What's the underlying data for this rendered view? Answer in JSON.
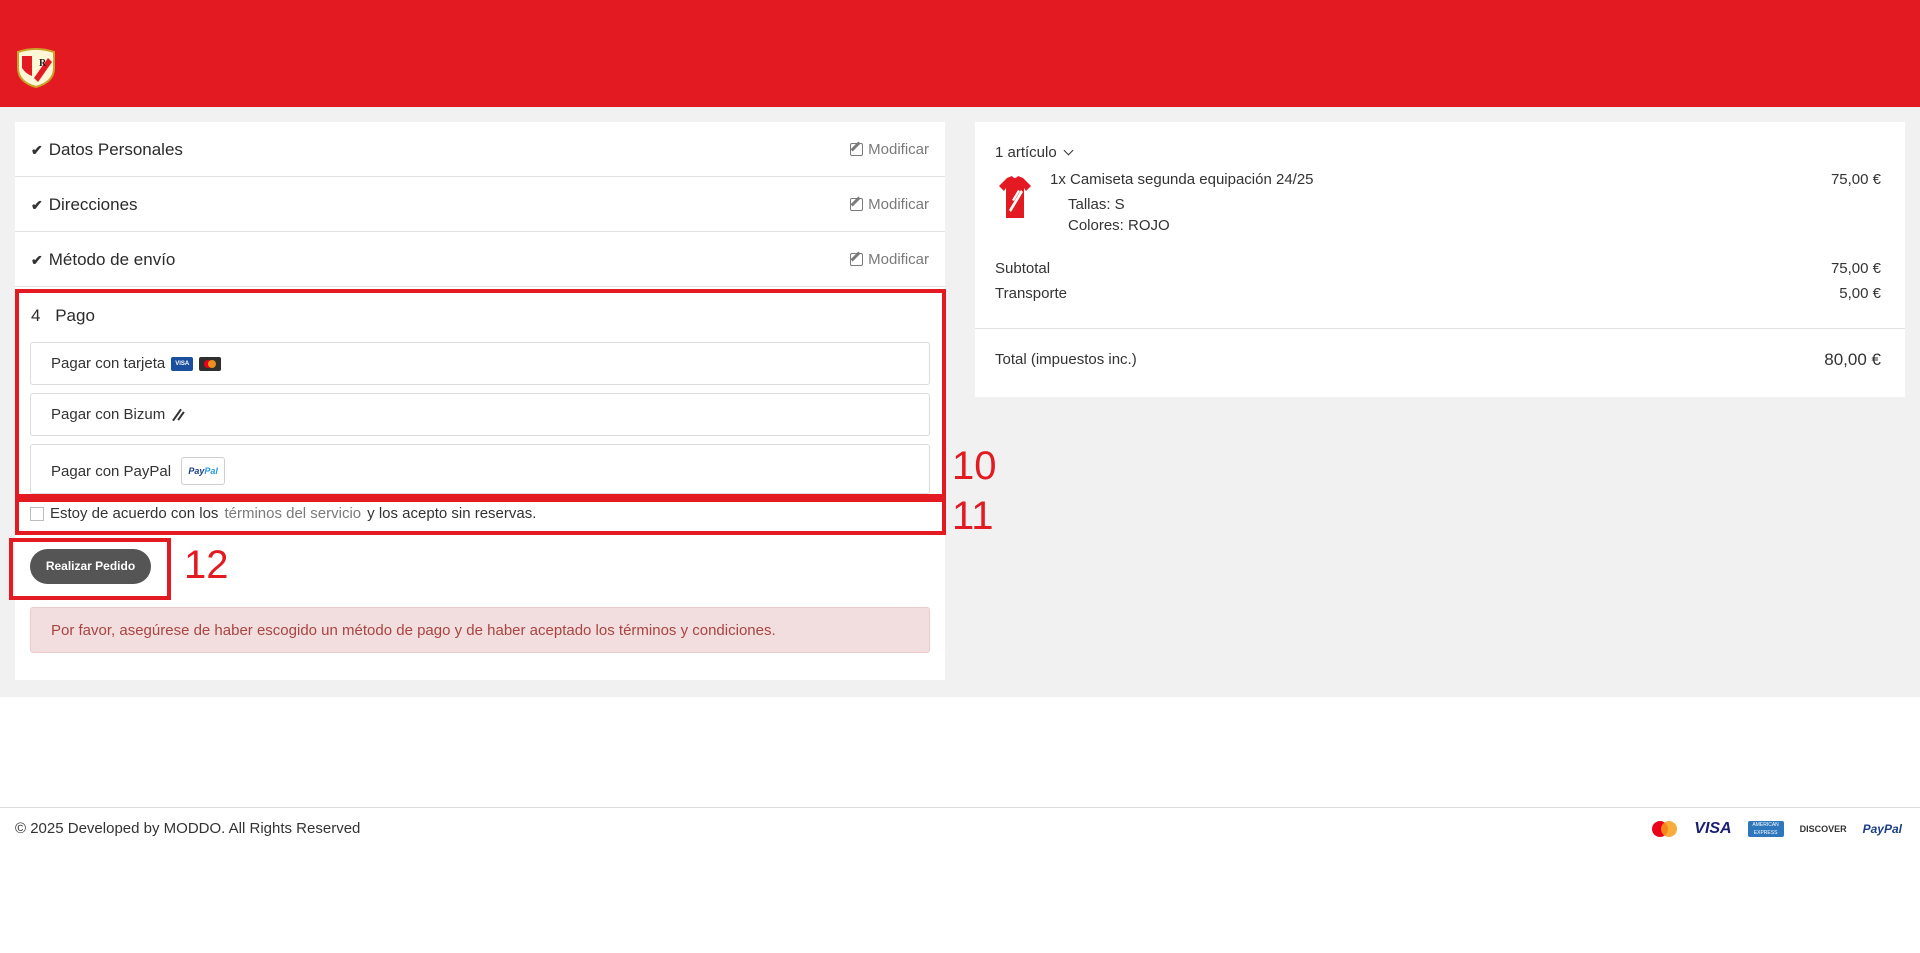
{
  "header": {
    "logo_icon": "club-crest-logo"
  },
  "checkout": {
    "steps": [
      {
        "title": "Datos Personales",
        "edit_label": "Modificar"
      },
      {
        "title": "Direcciones",
        "edit_label": "Modificar"
      },
      {
        "title": "Método de envío",
        "edit_label": "Modificar"
      }
    ],
    "payment": {
      "number": "4",
      "title": "Pago",
      "options": [
        {
          "label": "Pagar con tarjeta",
          "icons": [
            "visa-icon",
            "mastercard-icon"
          ]
        },
        {
          "label": "Pagar con Bizum",
          "icons": [
            "bizum-icon"
          ]
        },
        {
          "label": "Pagar con PayPal",
          "icons": [
            "paypal-icon"
          ]
        }
      ]
    },
    "terms": {
      "prefix": "Estoy de acuerdo con los",
      "link": "términos del servicio",
      "suffix": "y los acepto sin reservas."
    },
    "order_button": "Realizar Pedido",
    "alert": "Por favor, asegúrese de haber escogido un método de pago y de haber aceptado los términos y condiciones."
  },
  "annotations": [
    "10",
    "11",
    "12"
  ],
  "cart": {
    "count_label": "1 artículo",
    "product": {
      "name": "1x Camiseta segunda equipación 24/25",
      "price": "75,00 €",
      "size": "Tallas: S",
      "color": "Colores: ROJO"
    },
    "subtotal_label": "Subtotal",
    "subtotal_value": "75,00 €",
    "shipping_label": "Transporte",
    "shipping_value": "5,00 €",
    "total_label": "Total (impuestos inc.)",
    "total_value": "80,00 €"
  },
  "footer": {
    "copyright": "© 2025 Developed by MODDO. All Rights Reserved",
    "payment_logos": [
      "mastercard-logo",
      "visa-logo",
      "amex-logo",
      "discover-logo",
      "paypal-logo"
    ],
    "visa_text": "VISA",
    "amex_text": "AMERICAN EXPRESS",
    "discover_text": "DISCOVER",
    "paypal_text": "PayPal"
  },
  "colors": {
    "brand_red": "#e31a22",
    "button_gray": "#555555",
    "alert_bg": "#f2dede",
    "alert_text": "#a94442"
  }
}
